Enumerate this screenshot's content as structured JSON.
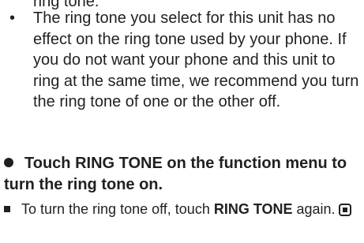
{
  "document": {
    "top_fragment": "ring tone.",
    "note": {
      "bullet": "•",
      "text": "The ring tone you select for this unit has no effect on the ring tone used by your phone. If you do not want your phone and this unit to ring at the same time, we recommend you turn the ring tone of one or the other off."
    },
    "step": {
      "heading": "Touch RING TONE on the function menu to turn the ring tone on."
    },
    "sub_note": {
      "prefix": "To turn the ring tone off, touch ",
      "bold": "RING TONE",
      "suffix": " again."
    }
  }
}
